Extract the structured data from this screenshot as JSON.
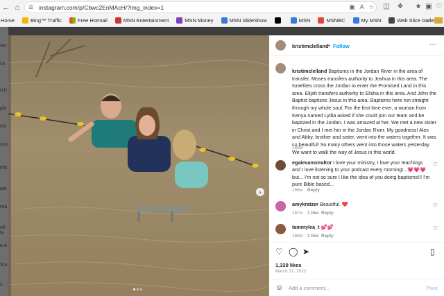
{
  "browser": {
    "url": "instagram.com/p/Cbwc2EnMAcH/?img_index=1",
    "favorites": [
      {
        "label": "Home",
        "color": "#ffffff"
      },
      {
        "label": "Bing™ Traffic",
        "color": "#f2b800"
      },
      {
        "label": "Free Hotmail",
        "color": "#f25022"
      },
      {
        "label": "MSN Entertainment",
        "color": "#cc3333"
      },
      {
        "label": "MSN Money",
        "color": "#7f3fbf"
      },
      {
        "label": "MSN SlideShow",
        "color": "#3a7bd5"
      },
      {
        "label": "",
        "color": "#000000"
      },
      {
        "label": "MSN",
        "color": "#3a7bd5"
      },
      {
        "label": "MSNBC",
        "color": "#e0483e"
      },
      {
        "label": "My MSN",
        "color": "#3a7bd5"
      },
      {
        "label": "Web Slice Gallery",
        "color": "#444444"
      }
    ]
  },
  "background_sidebar": [
    "Ho",
    "ch",
    "rch",
    "plo",
    "els",
    "ssa",
    "tific",
    "ate",
    "rea",
    "ofi",
    "hr",
    "a A",
    "Stu",
    "s"
  ],
  "post": {
    "username": "kristimclelland",
    "follow_label": "Follow",
    "caption_user": "kristimclelland",
    "caption_text": "Baptisms in the Jordan River in the area of transfer. Moses transfers authority to Joshua in this area. The Israelites cross the Jordan to enter the Promised Land in this area. Elijah transfers authority to Elisha in this area. And John the Baptist baptizes Jesus in this area. Baptisms here run straight through my whole soul. For the first time ever, a woman from Kenya named Lydia asked if she could join our team and be baptized in the Jordan. I was amazed at her. We met a new sister in Christ and I met her in the Jordan River. My goodness! Alex and Abby, brother and sister, went into the waters together. It was so beautiful! So many others went into those waters yesterday. We want to walk the way of Jesus in this world.",
    "caption_time": "168w",
    "comments": [
      {
        "user": "egaievansrealtor",
        "text": "I love your ministry, I love your teachings and I love listening to your podcast every morning!...💗💗💗 but... I'm not so sure I like the idea of you doing baptisms!!! I'm pure Bible based...",
        "time": "166w",
        "likes": "",
        "reply": "Reply"
      },
      {
        "user": "amykratzer",
        "text": "Beautiful. ❤️",
        "time": "167w",
        "likes": "1 like",
        "reply": "Reply"
      },
      {
        "user": "tammylea_t",
        "text": "💕💕",
        "time": "168w",
        "likes": "1 like",
        "reply": "Reply"
      }
    ],
    "likes_count": "1,339 likes",
    "date": "March 31, 2022",
    "add_comment_placeholder": "Add a comment...",
    "post_label": "Post"
  }
}
